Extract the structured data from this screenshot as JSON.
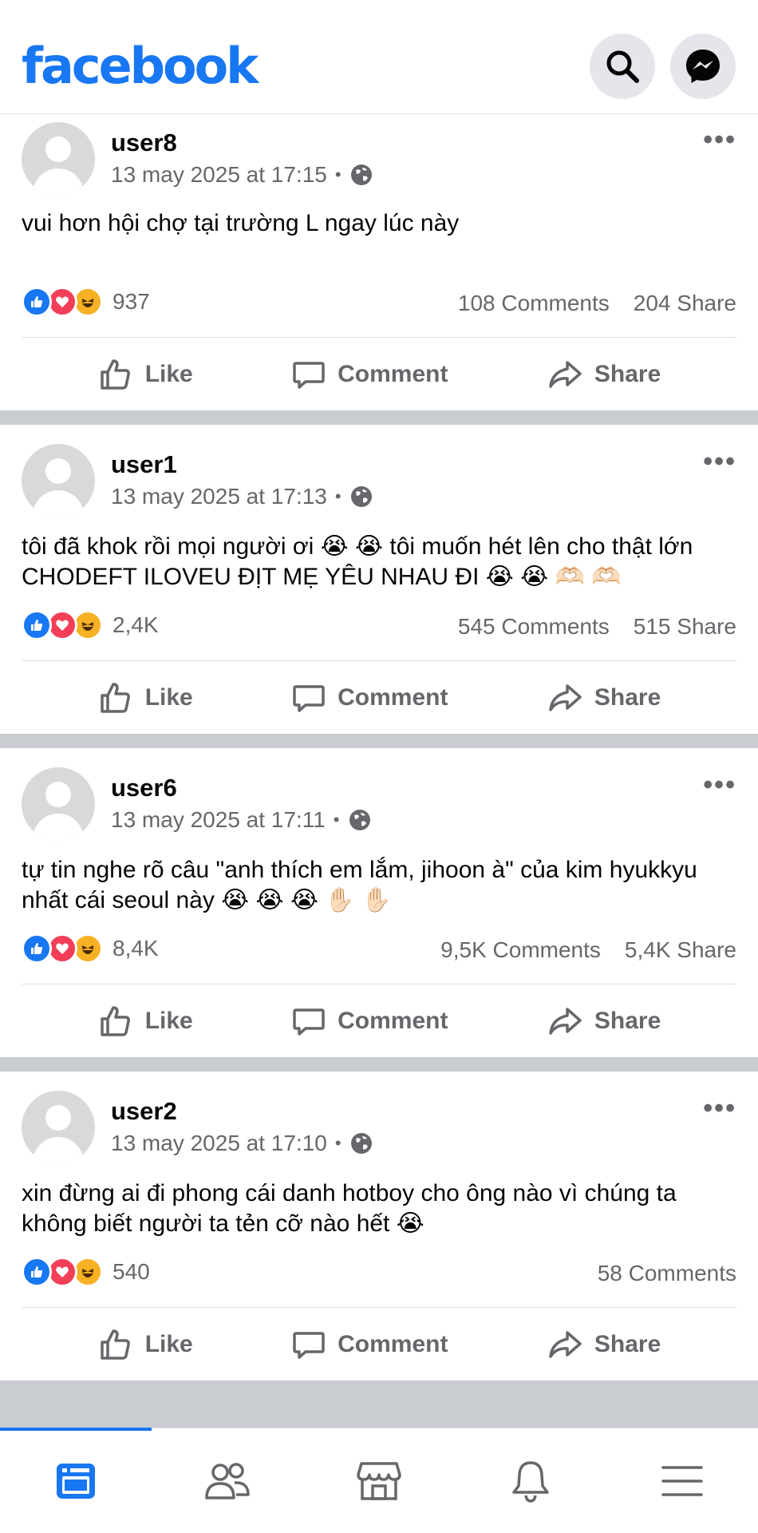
{
  "header": {
    "logo": "facebook",
    "search_icon": "search-icon",
    "messenger_icon": "messenger-icon"
  },
  "colors": {
    "brand": "#1877f2",
    "text_secondary": "#65676b",
    "divider": "#c9ccd1",
    "like": "#1877f2",
    "love": "#f33e58",
    "haha": "#f7b125"
  },
  "actions": {
    "like": "Like",
    "comment": "Comment",
    "share": "Share"
  },
  "posts": [
    {
      "user": "user8",
      "time": "13 may 2025 at 17:15",
      "text": "vui hơn hội chợ tại trường L ngay lúc này",
      "reactions": "937",
      "comments": "108 Comments",
      "shares": "204 Share"
    },
    {
      "user": "user1",
      "time": "13 may 2025 at 17:13",
      "text": "tôi đã khok rồi mọi người ơi 😭 😭  tôi muốn hét lên cho thật lớn CHODEFT ILOVEU ĐỊT MẸ YÊU NHAU ĐI 😭 😭 🫶🏻 🫶🏻",
      "reactions": "2,4K",
      "comments": "545 Comments",
      "shares": "515 Share"
    },
    {
      "user": "user6",
      "time": "13 may 2025 at 17:11",
      "text": "tự tin nghe rõ câu \"anh thích em lắm, jihoon à\" của kim hyukkyu nhất cái seoul này 😭 😭 😭 ✋🏻 ✋🏻",
      "reactions": "8,4K",
      "comments": "9,5K Comments",
      "shares": "5,4K Share"
    },
    {
      "user": "user2",
      "time": "13 may 2025 at 17:10",
      "text": "xin đừng ai đi phong cái danh hotboy cho ông nào vì chúng ta không biết người ta tẻn cỡ nào hết 😭",
      "reactions": "540",
      "comments": "58 Comments",
      "shares": ""
    }
  ],
  "bottom_nav": [
    {
      "icon": "feed-icon",
      "active": true
    },
    {
      "icon": "friends-icon",
      "active": false
    },
    {
      "icon": "marketplace-icon",
      "active": false
    },
    {
      "icon": "notifications-icon",
      "active": false
    },
    {
      "icon": "menu-icon",
      "active": false
    }
  ]
}
